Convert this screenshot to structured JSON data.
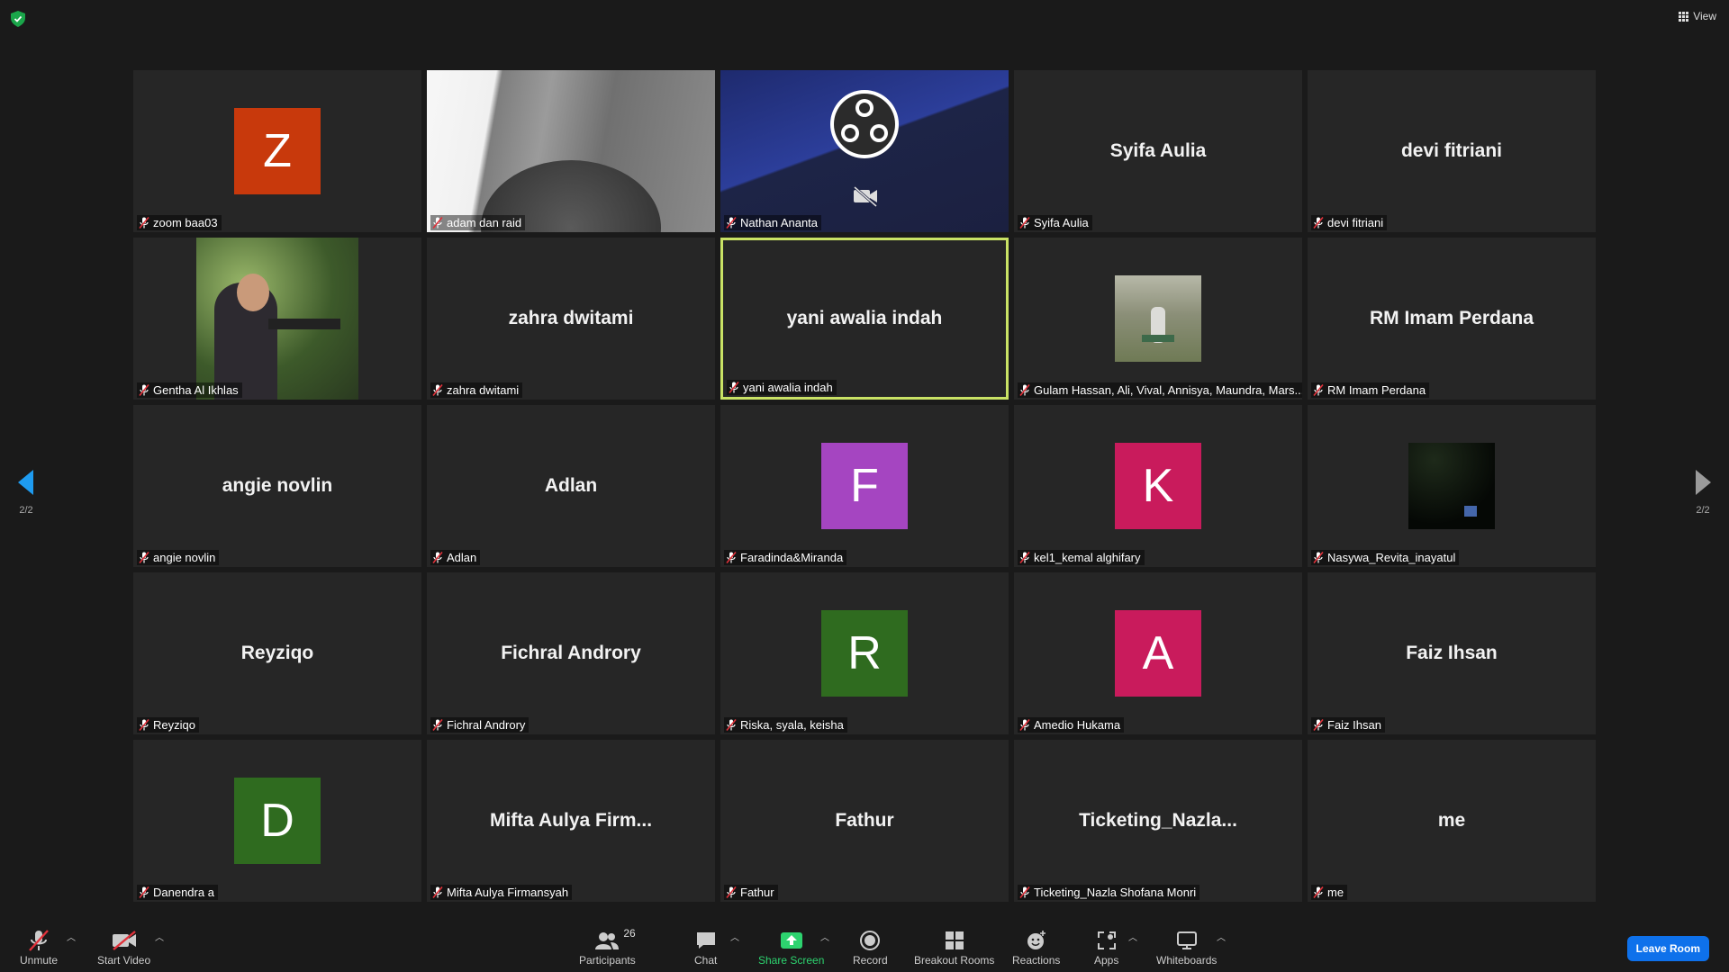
{
  "view_label": "View",
  "page_indicator": "2/2",
  "colors": {
    "active_border": "#c9e265",
    "leave_button": "#0e71eb",
    "share_green": "#2dd36f"
  },
  "tiles": [
    {
      "label": "zoom baa03",
      "avatar": "Z",
      "avatar_color": "#c8390c"
    },
    {
      "label": "adam dan raid",
      "video": "room ceiling photo"
    },
    {
      "label": "Nathan Ananta",
      "video": "obs logo, camera off"
    },
    {
      "label": "Syifa Aulia",
      "center": "Syifa Aulia"
    },
    {
      "label": "devi fitriani",
      "center": "devi fitriani"
    },
    {
      "label": "Gentha Al Ikhlas",
      "video": "person aiming pistol"
    },
    {
      "label": "zahra dwitami",
      "center": "zahra dwitami"
    },
    {
      "label": "yani awalia indah",
      "center": "yani awalia indah",
      "active": true
    },
    {
      "label": "Gulam Hassan, Ali, Vival, Annisya, Maundra, Mars...",
      "video": "person sitting outdoors"
    },
    {
      "label": "RM Imam Perdana",
      "center": "RM Imam Perdana"
    },
    {
      "label": "angie novlin",
      "center": "angie novlin"
    },
    {
      "label": "Adlan",
      "center": "Adlan"
    },
    {
      "label": "Faradinda&Miranda",
      "avatar": "F",
      "avatar_color": "#a545c1"
    },
    {
      "label": "kel1_kemal alghifary",
      "avatar": "K",
      "avatar_color": "#c91b5c"
    },
    {
      "label": "Nasywa_Revita_inayatul",
      "video": "dark night photo"
    },
    {
      "label": "Reyziqo",
      "center": "Reyziqo"
    },
    {
      "label": "Fichral Androry",
      "center": "Fichral Androry"
    },
    {
      "label": "Riska, syala, keisha",
      "avatar": "R",
      "avatar_color": "#2f6b1f"
    },
    {
      "label": "Amedio Hukama",
      "avatar": "A",
      "avatar_color": "#c91b5c"
    },
    {
      "label": "Faiz Ihsan",
      "center": "Faiz Ihsan"
    },
    {
      "label": "Danendra a",
      "avatar": "D",
      "avatar_color": "#2f6b1f"
    },
    {
      "label": "Mifta Aulya Firmansyah",
      "center": "Mifta  Aulya  Firm..."
    },
    {
      "label": "Fathur",
      "center": "Fathur"
    },
    {
      "label": "Ticketing_Nazla Shofana Monri",
      "center": "Ticketing_Nazla..."
    },
    {
      "label": "me",
      "center": "me"
    }
  ],
  "toolbar": {
    "unmute": "Unmute",
    "start_video": "Start Video",
    "participants": "Participants",
    "participants_count": "26",
    "chat": "Chat",
    "share_screen": "Share Screen",
    "record": "Record",
    "breakout_rooms": "Breakout Rooms",
    "reactions": "Reactions",
    "apps": "Apps",
    "whiteboards": "Whiteboards",
    "leave": "Leave Room"
  }
}
